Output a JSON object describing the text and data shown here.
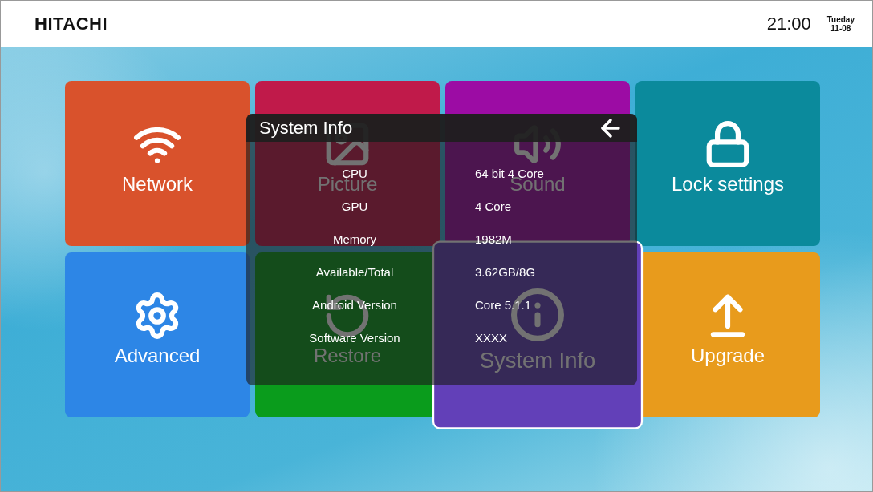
{
  "header": {
    "brand": "HITACHI",
    "time": "21:00",
    "day": "Tueday",
    "date": "11-08"
  },
  "tiles": [
    {
      "label": "Network",
      "kind": "wifi",
      "color": "#d9522c",
      "selected": false
    },
    {
      "label": "Picture",
      "kind": "picture",
      "color": "#c01a4a",
      "selected": false
    },
    {
      "label": "Sound",
      "kind": "sound",
      "color": "#9c0ca4",
      "selected": false
    },
    {
      "label": "Lock settings",
      "kind": "lock",
      "color": "#0b8a9c",
      "selected": false
    },
    {
      "label": "Advanced",
      "kind": "gear",
      "color": "#2d86e6",
      "selected": false
    },
    {
      "label": "Restore",
      "kind": "restore",
      "color": "#0a9c1c",
      "selected": false
    },
    {
      "label": "System Info",
      "kind": "info",
      "color": "#6240b8",
      "selected": true
    },
    {
      "label": "Upgrade",
      "kind": "upgrade",
      "color": "#e89b1c",
      "selected": false
    }
  ],
  "dialog": {
    "title": "System Info",
    "rows": [
      {
        "label": "CPU",
        "value": "64 bit 4 Core"
      },
      {
        "label": "GPU",
        "value": "4 Core"
      },
      {
        "label": "Memory",
        "value": "1982M"
      },
      {
        "label": "Available/Total",
        "value": "3.62GB/8G"
      },
      {
        "label": "Android Version",
        "value": "Core 5.1.1"
      },
      {
        "label": "Software Version",
        "value": "XXXX"
      }
    ]
  }
}
